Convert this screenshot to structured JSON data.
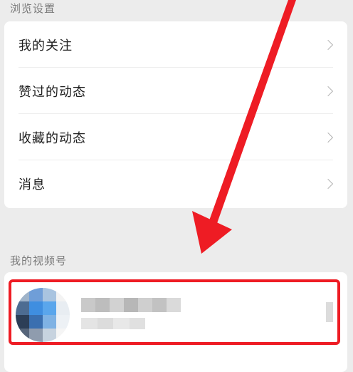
{
  "sections": {
    "browse": {
      "label": "浏览设置",
      "items": [
        {
          "label": "我的关注"
        },
        {
          "label": "赞过的动态"
        },
        {
          "label": "收藏的动态"
        },
        {
          "label": "消息"
        }
      ]
    },
    "channel": {
      "label": "我的视频号"
    }
  },
  "colors": {
    "annotation_red": "#ee1c24"
  },
  "icons": {
    "row_chevron": "chevron-right-icon"
  }
}
